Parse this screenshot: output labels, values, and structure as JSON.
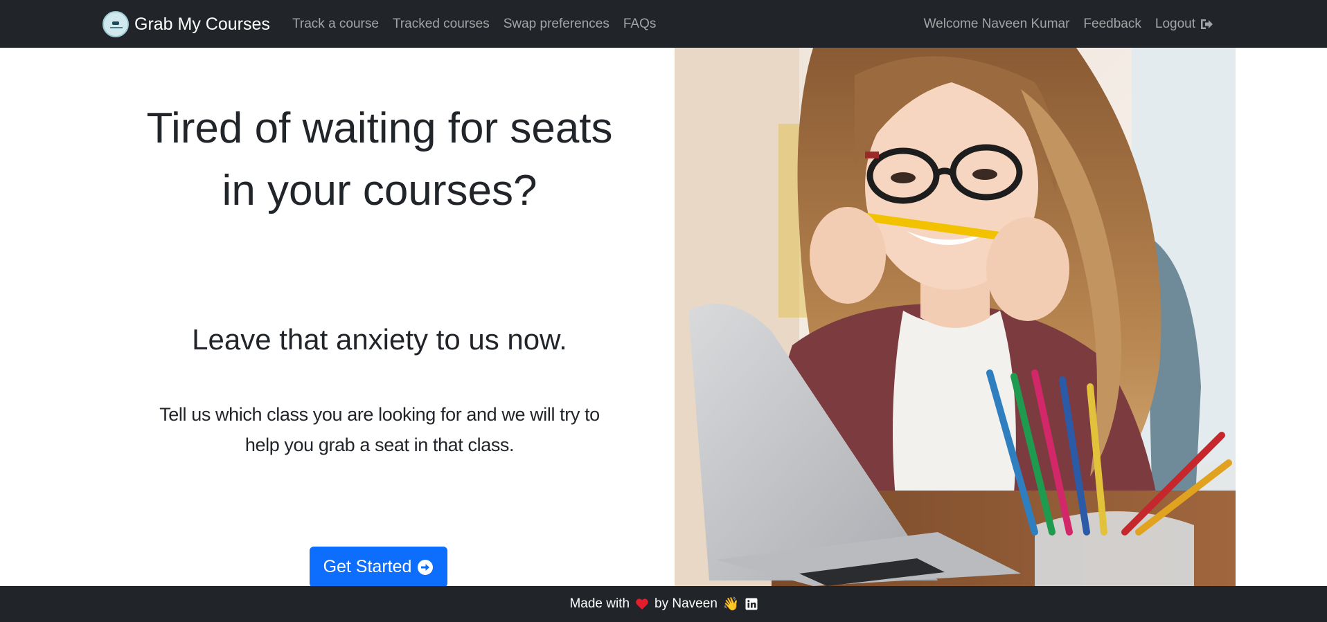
{
  "navbar": {
    "brand": "Grab My Courses",
    "links": [
      "Track a course",
      "Tracked courses",
      "Swap preferences",
      "FAQs"
    ],
    "welcome": "Welcome Naveen Kumar",
    "feedback": "Feedback",
    "logout": "Logout"
  },
  "hero": {
    "headline": "Tired of waiting for seats in your courses?",
    "subheadline": "Leave that anxiety to us now.",
    "lead": "Tell us which class you are looking for and we will try to help you grab a seat in that class.",
    "cta": "Get Started"
  },
  "footer": {
    "made_with": "Made with",
    "by": "by Naveen",
    "wave": "👋"
  },
  "colors": {
    "navbar_bg": "#212529",
    "primary": "#0d6efd",
    "heart": "#e11d2e"
  },
  "icons": [
    "logout-icon",
    "arrow-circle-right-icon",
    "heart-icon",
    "linkedin-icon",
    "graduation-cap-logo"
  ]
}
